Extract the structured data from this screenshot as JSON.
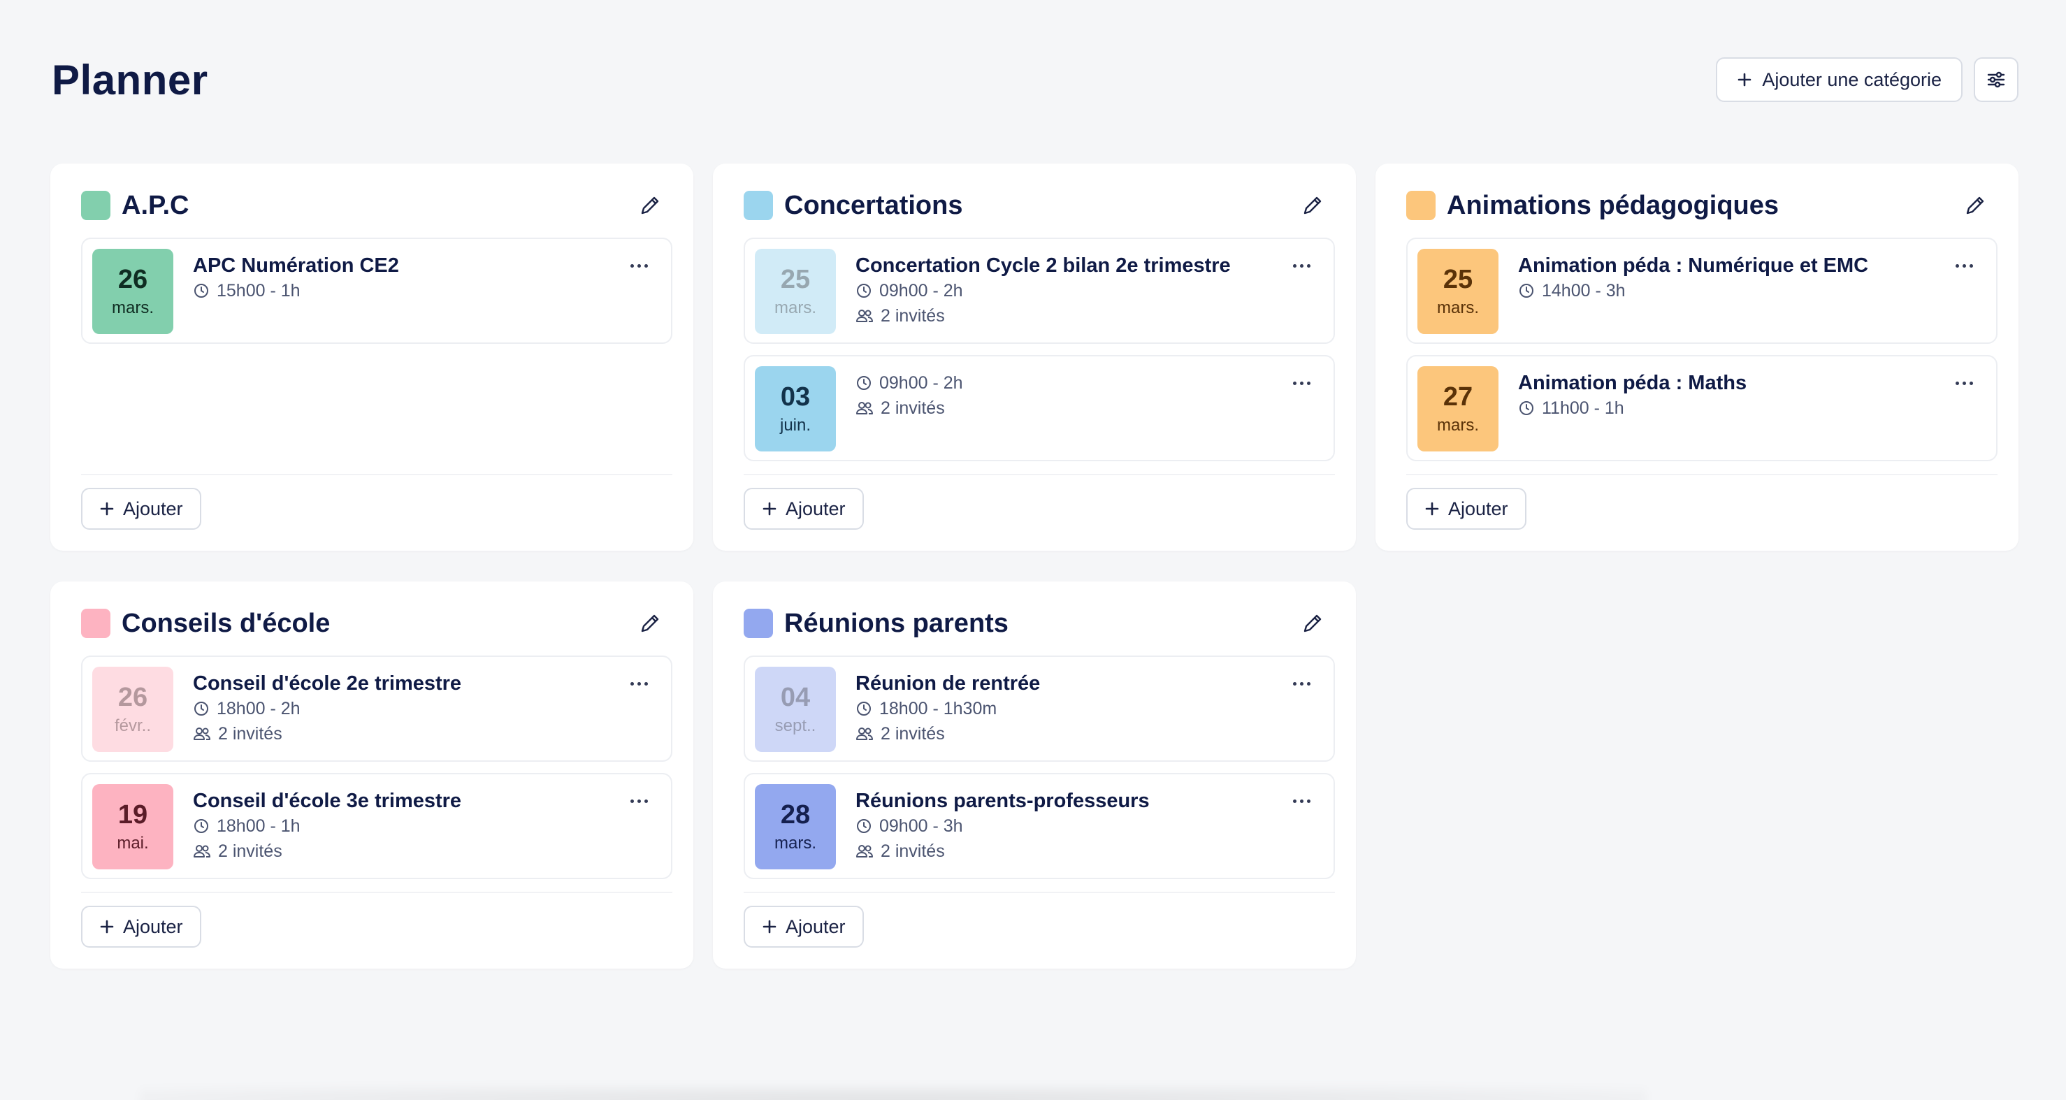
{
  "header": {
    "title": "Planner",
    "add_category_label": "Ajouter une catégorie"
  },
  "categories": [
    {
      "name": "A.P.C",
      "color": "#82cfad",
      "events": [
        {
          "day": "26",
          "month": "mars.",
          "title": "APC Numération CE2",
          "time": "15h00 - 1h",
          "guests": "",
          "faded": false,
          "tile_bg": "#82cfad",
          "tile_fg": "#0f2d22"
        }
      ]
    },
    {
      "name": "Concertations",
      "color": "#9bd5ee",
      "events": [
        {
          "day": "25",
          "month": "mars.",
          "title": "Concertation Cycle 2 bilan 2e trimestre",
          "time": "09h00 - 2h",
          "guests": "2 invités",
          "faded": true,
          "tile_bg": "#9bd5ee",
          "tile_fg": "#1a3d52"
        },
        {
          "day": "03",
          "month": "juin.",
          "title": "",
          "time": "09h00 - 2h",
          "guests": "2 invités",
          "faded": false,
          "tile_bg": "#9bd5ee",
          "tile_fg": "#12324a"
        }
      ]
    },
    {
      "name": "Animations pédagogiques",
      "color": "#fcc67c",
      "events": [
        {
          "day": "25",
          "month": "mars.",
          "title": "Animation péda : Numérique et EMC",
          "time": "14h00 - 3h",
          "guests": "",
          "faded": false,
          "tile_bg": "#fcc67c",
          "tile_fg": "#5a3208"
        },
        {
          "day": "27",
          "month": "mars.",
          "title": "Animation péda : Maths",
          "time": "11h00 - 1h",
          "guests": "",
          "faded": false,
          "tile_bg": "#fcc67c",
          "tile_fg": "#5a3208"
        }
      ]
    },
    {
      "name": "Conseils d'école",
      "color": "#fdb3c1",
      "events": [
        {
          "day": "26",
          "month": "févr..",
          "title": "Conseil d'école 2e trimestre",
          "time": "18h00 - 2h",
          "guests": "2 invités",
          "faded": true,
          "tile_bg": "#fdb3c1",
          "tile_fg": "#5a1c28"
        },
        {
          "day": "19",
          "month": "mai.",
          "title": "Conseil d'école 3e trimestre",
          "time": "18h00 - 1h",
          "guests": "2 invités",
          "faded": false,
          "tile_bg": "#fdb3c1",
          "tile_fg": "#5a1c28"
        }
      ]
    },
    {
      "name": "Réunions parents",
      "color": "#93a8ef",
      "events": [
        {
          "day": "04",
          "month": "sept..",
          "title": "Réunion de rentrée",
          "time": "18h00 - 1h30m",
          "guests": "2 invités",
          "faded": true,
          "tile_bg": "#93a8ef",
          "tile_fg": "#1b2658"
        },
        {
          "day": "28",
          "month": "mars.",
          "title": "Réunions parents-professeurs",
          "time": "09h00 - 3h",
          "guests": "2 invités",
          "faded": false,
          "tile_bg": "#93a8ef",
          "tile_fg": "#15204f"
        }
      ]
    }
  ],
  "add_label": "Ajouter"
}
